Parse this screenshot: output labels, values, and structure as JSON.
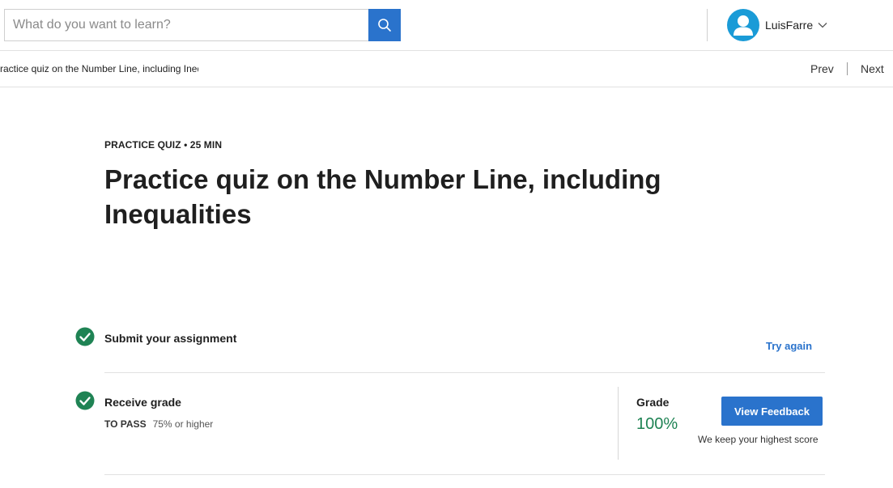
{
  "search": {
    "placeholder": "What do you want to learn?",
    "icon": "search-icon"
  },
  "user": {
    "name": "LuisFarre",
    "avatar_icon": "user-avatar-icon",
    "menu_icon": "chevron-down-icon"
  },
  "breadcrumb": {
    "text": "Practice quiz on the Number Line, including Inequalities"
  },
  "pager": {
    "prev": "Prev",
    "next": "Next"
  },
  "quiz": {
    "eyebrow": "PRACTICE QUIZ • 25 MIN",
    "title": "Practice quiz on the Number Line, including Inequalities"
  },
  "steps": {
    "submit": {
      "label": "Submit your assignment",
      "action": "Try again",
      "icon": "check-circle-icon"
    },
    "grade": {
      "label": "Receive grade",
      "pass_label": "TO PASS",
      "pass_value": "75% or higher",
      "grade_label": "Grade",
      "grade_value": "100%",
      "button": "View Feedback",
      "note": "We keep your highest score",
      "icon": "check-circle-icon"
    }
  },
  "colors": {
    "accent": "#2a73cc",
    "success": "#1f8354",
    "avatar": "#1a9bd7"
  }
}
